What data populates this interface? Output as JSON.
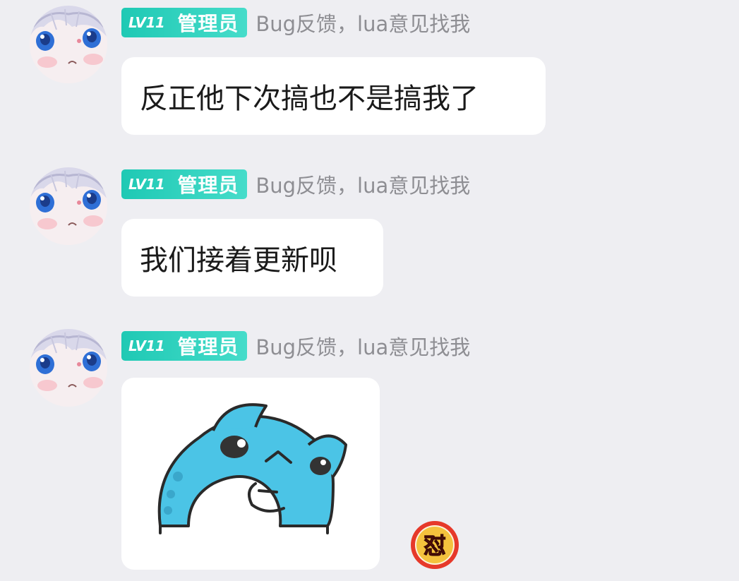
{
  "messages": [
    {
      "sender": {
        "level": "LV11",
        "role": "管理员",
        "title": "Bug反馈，lua意见找我"
      },
      "type": "text",
      "text": "反正他下次搞也不是搞我了"
    },
    {
      "sender": {
        "level": "LV11",
        "role": "管理员",
        "title": "Bug反馈，lua意见找我"
      },
      "type": "text",
      "text": "我们接着更新呗"
    },
    {
      "sender": {
        "level": "LV11",
        "role": "管理员",
        "title": "Bug反馈，lua意见找我"
      },
      "type": "sticker",
      "sticker": "blue-cat-thinking-sticker"
    }
  ],
  "reaction": {
    "icon": "dui-reaction-icon",
    "label": "怼"
  },
  "colors": {
    "background": "#eeeef2",
    "badge": "#1fc9b4",
    "title_text": "#8e8e93",
    "bubble": "#ffffff",
    "sticker_blue": "#4bc4e6"
  }
}
